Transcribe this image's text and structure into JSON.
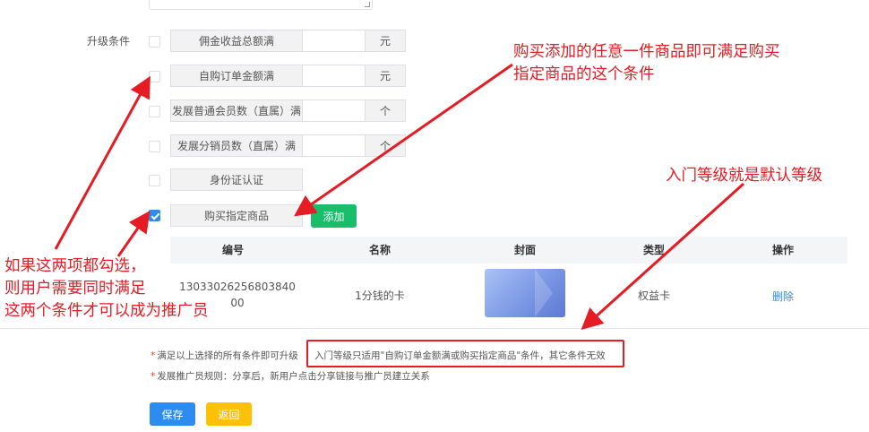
{
  "form": {
    "upgrade_label": "升级条件",
    "conditions": [
      {
        "label": "佣金收益总额满",
        "unit": "元",
        "checked": false
      },
      {
        "label": "自购订单金额满",
        "unit": "元",
        "checked": false
      },
      {
        "label": "发展普通会员数（直属）满",
        "unit": "个",
        "checked": false
      },
      {
        "label": "发展分销员数（直属）满",
        "unit": "个",
        "checked": false
      },
      {
        "label": "身份证认证",
        "checked": false
      },
      {
        "label": "购买指定商品",
        "checked": true
      }
    ],
    "add_button": "添加"
  },
  "table": {
    "headers": [
      "编号",
      "名称",
      "封面",
      "类型",
      "操作"
    ],
    "rows": [
      {
        "id_line1": "13033026256803840",
        "id_line2": "00",
        "name": "1分钱的卡",
        "type": "权益卡",
        "action": "删除"
      }
    ]
  },
  "notes": {
    "star": "*",
    "line1": "满足以上选择的所有条件即可升级",
    "line1_boxed": "入门等级只适用\"自购订单金额满或购买指定商品\"条件，其它条件无效",
    "line2": "发展推广员规则：分享后，新用户点击分享链接与推广员建立关系"
  },
  "buttons": {
    "save": "保存",
    "back": "返回"
  },
  "annotations": {
    "top_right_line1": "购买添加的任意一件商品即可满足购买",
    "top_right_line2": "指定商品的这个条件",
    "middle_right": "入门等级就是默认等级",
    "left_line1": "如果这两项都勾选，",
    "left_line2": "则用户需要同时满足",
    "left_line3": "这两个条件才可以成为推广员"
  },
  "colors": {
    "annotation_red": "#e51c23",
    "primary_blue": "#2d8cf0",
    "add_green": "#19be6b",
    "back_yellow": "#ffc107"
  }
}
